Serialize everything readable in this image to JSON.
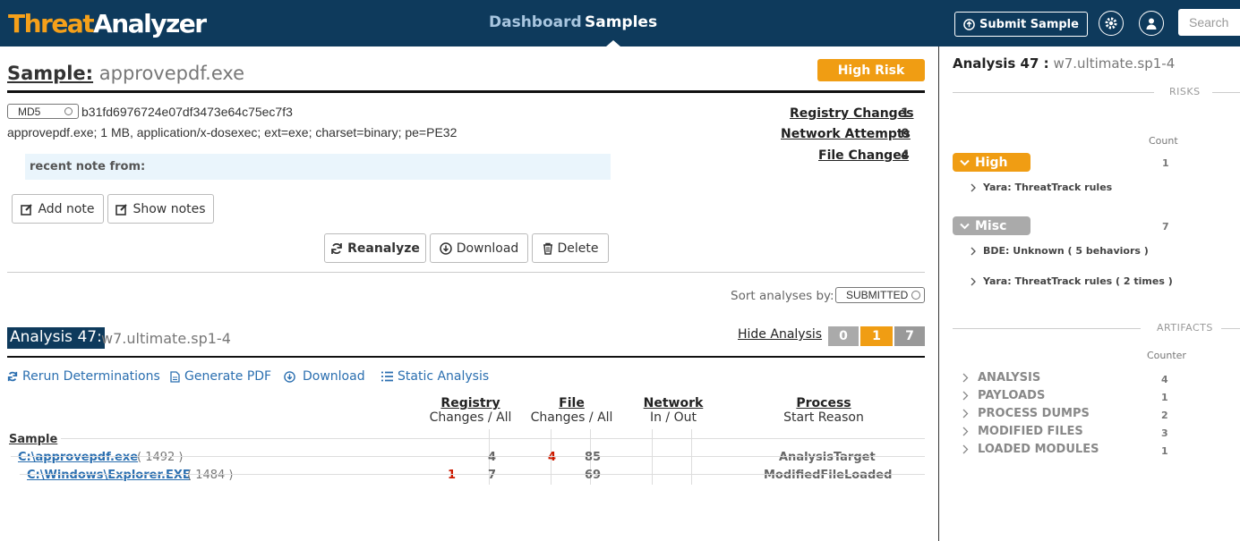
{
  "header": {
    "logo_threat": "Threat",
    "logo_analyzer": "Analyzer",
    "nav": [
      "Dashboard",
      "Samples"
    ],
    "submit_label": "Submit Sample",
    "search_placeholder": "Search",
    "brand_color": "#0e3a5c",
    "accent_color": "#f5a01a"
  },
  "sample": {
    "title_label": "Sample:",
    "name": "approvepdf.exe",
    "risk_badge": "High Risk",
    "hash_type": "MD5",
    "hash": "b31fd6976724e07df3473e64c75ec7f3",
    "info": "approvepdf.exe; 1 MB, application/x-dosexec; ext=exe; charset=binary; pe=PE32",
    "note_label": "recent note from:",
    "stats": [
      {
        "label": "Registry Changes",
        "value": "1"
      },
      {
        "label": "Network Attempts",
        "value": "0"
      },
      {
        "label": "File Changes",
        "value": "4"
      }
    ],
    "buttons": {
      "add_note": "Add note",
      "show_notes": "Show notes",
      "reanalyze": "Reanalyze",
      "download": "Download",
      "delete": "Delete"
    },
    "sort_label": "Sort analyses by:",
    "sort_value": "SUBMITTED"
  },
  "analysis": {
    "label": "Analysis 47:",
    "host": "w7.ultimate.sp1-4",
    "hide_label": "Hide Analysis",
    "counts": [
      "0",
      "1",
      "7"
    ],
    "toolbar": [
      "Rerun Determinations",
      "Generate PDF",
      "Download",
      "Static Analysis"
    ],
    "columns": {
      "registry": {
        "title": "Registry",
        "sub": "Changes / All"
      },
      "file": {
        "title": "File",
        "sub": "Changes / All"
      },
      "network": {
        "title": "Network",
        "sub": "In / Out"
      },
      "process": {
        "title": "Process",
        "sub": "Start Reason"
      }
    },
    "sample_header": "Sample",
    "rows": [
      {
        "path": "C:\\approvepdf.exe",
        "pid": "( 1492 )",
        "reg_changes": "",
        "reg_all": "4",
        "file_changes": "4",
        "file_all": "85",
        "reason": "AnalysisTarget"
      },
      {
        "path": "C:\\Windows\\Explorer.EXE",
        "pid": "( 1484 )",
        "reg_changes": "1",
        "reg_all": "7",
        "file_changes": "",
        "file_all": "69",
        "reason": "ModifiedFileLoaded"
      }
    ]
  },
  "sidebar": {
    "title_label": "Analysis 47 :",
    "title_host": "w7.ultimate.sp1-4",
    "risks_header": "RISKS",
    "count_label": "Count",
    "risk_groups": [
      {
        "name": "High",
        "count": "1",
        "color": "#f09d13",
        "items": [
          "Yara: ThreatTrack rules"
        ]
      },
      {
        "name": "Misc",
        "count": "7",
        "color": "#aaaaaa",
        "items": [
          "BDE: Unknown ( 5 behaviors )",
          "Yara: ThreatTrack rules ( 2 times )"
        ]
      }
    ],
    "artifacts_header": "ARTIFACTS",
    "counter_label": "Counter",
    "artifacts": [
      {
        "name": "ANALYSIS",
        "count": "4"
      },
      {
        "name": "PAYLOADS",
        "count": "1"
      },
      {
        "name": "PROCESS DUMPS",
        "count": "2"
      },
      {
        "name": "MODIFIED FILES",
        "count": "3"
      },
      {
        "name": "LOADED MODULES",
        "count": "1"
      }
    ]
  }
}
